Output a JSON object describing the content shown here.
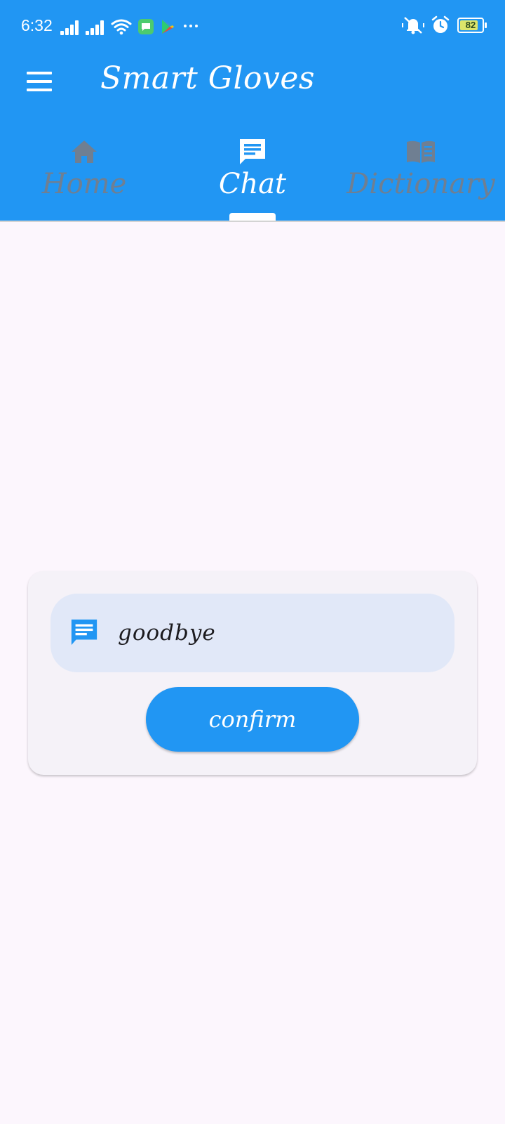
{
  "status_bar": {
    "time": "6:32",
    "battery_level": "82",
    "battery_fraction": 0.82
  },
  "app_bar": {
    "title": "Smart Gloves",
    "menu_icon": "menu-icon"
  },
  "tabs": [
    {
      "label": "Home",
      "icon": "home-icon",
      "selected": false
    },
    {
      "label": "Chat",
      "icon": "chat-icon",
      "selected": true
    },
    {
      "label": "Dictionary",
      "icon": "book-icon",
      "selected": false
    }
  ],
  "chat_card": {
    "input_value": "goodbye",
    "input_icon": "chat-icon",
    "confirm_label": "confirm"
  },
  "colors": {
    "primary": "#2196f3",
    "background": "#fcf6fd",
    "card": "#f5f2f8",
    "input": "#e1e8f8",
    "inactive_tab": "#6f7f92"
  }
}
